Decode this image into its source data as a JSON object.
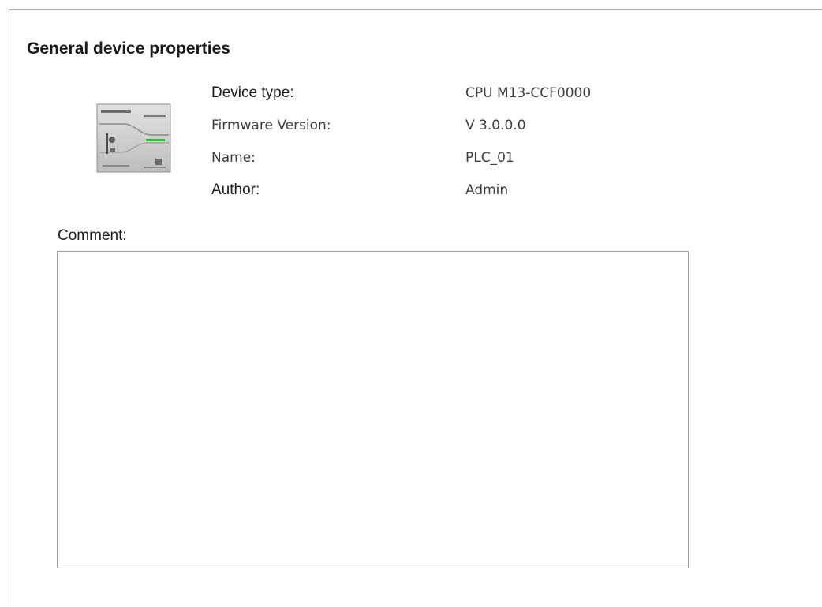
{
  "section": {
    "title": "General device properties"
  },
  "device": {
    "icon": "plc-module-icon",
    "properties": [
      {
        "label": "Device type:",
        "value": "CPU M13-CCF0000"
      },
      {
        "label": "Firmware Version:",
        "value": "V 3.0.0.0"
      },
      {
        "label": "Name:",
        "value": "PLC_01"
      },
      {
        "label": "Author:",
        "value": "Admin"
      }
    ]
  },
  "comment": {
    "label": "Comment:",
    "value": ""
  },
  "colors": {
    "status_led": "#2fbf2f",
    "module_body": "#cfcfcf"
  }
}
